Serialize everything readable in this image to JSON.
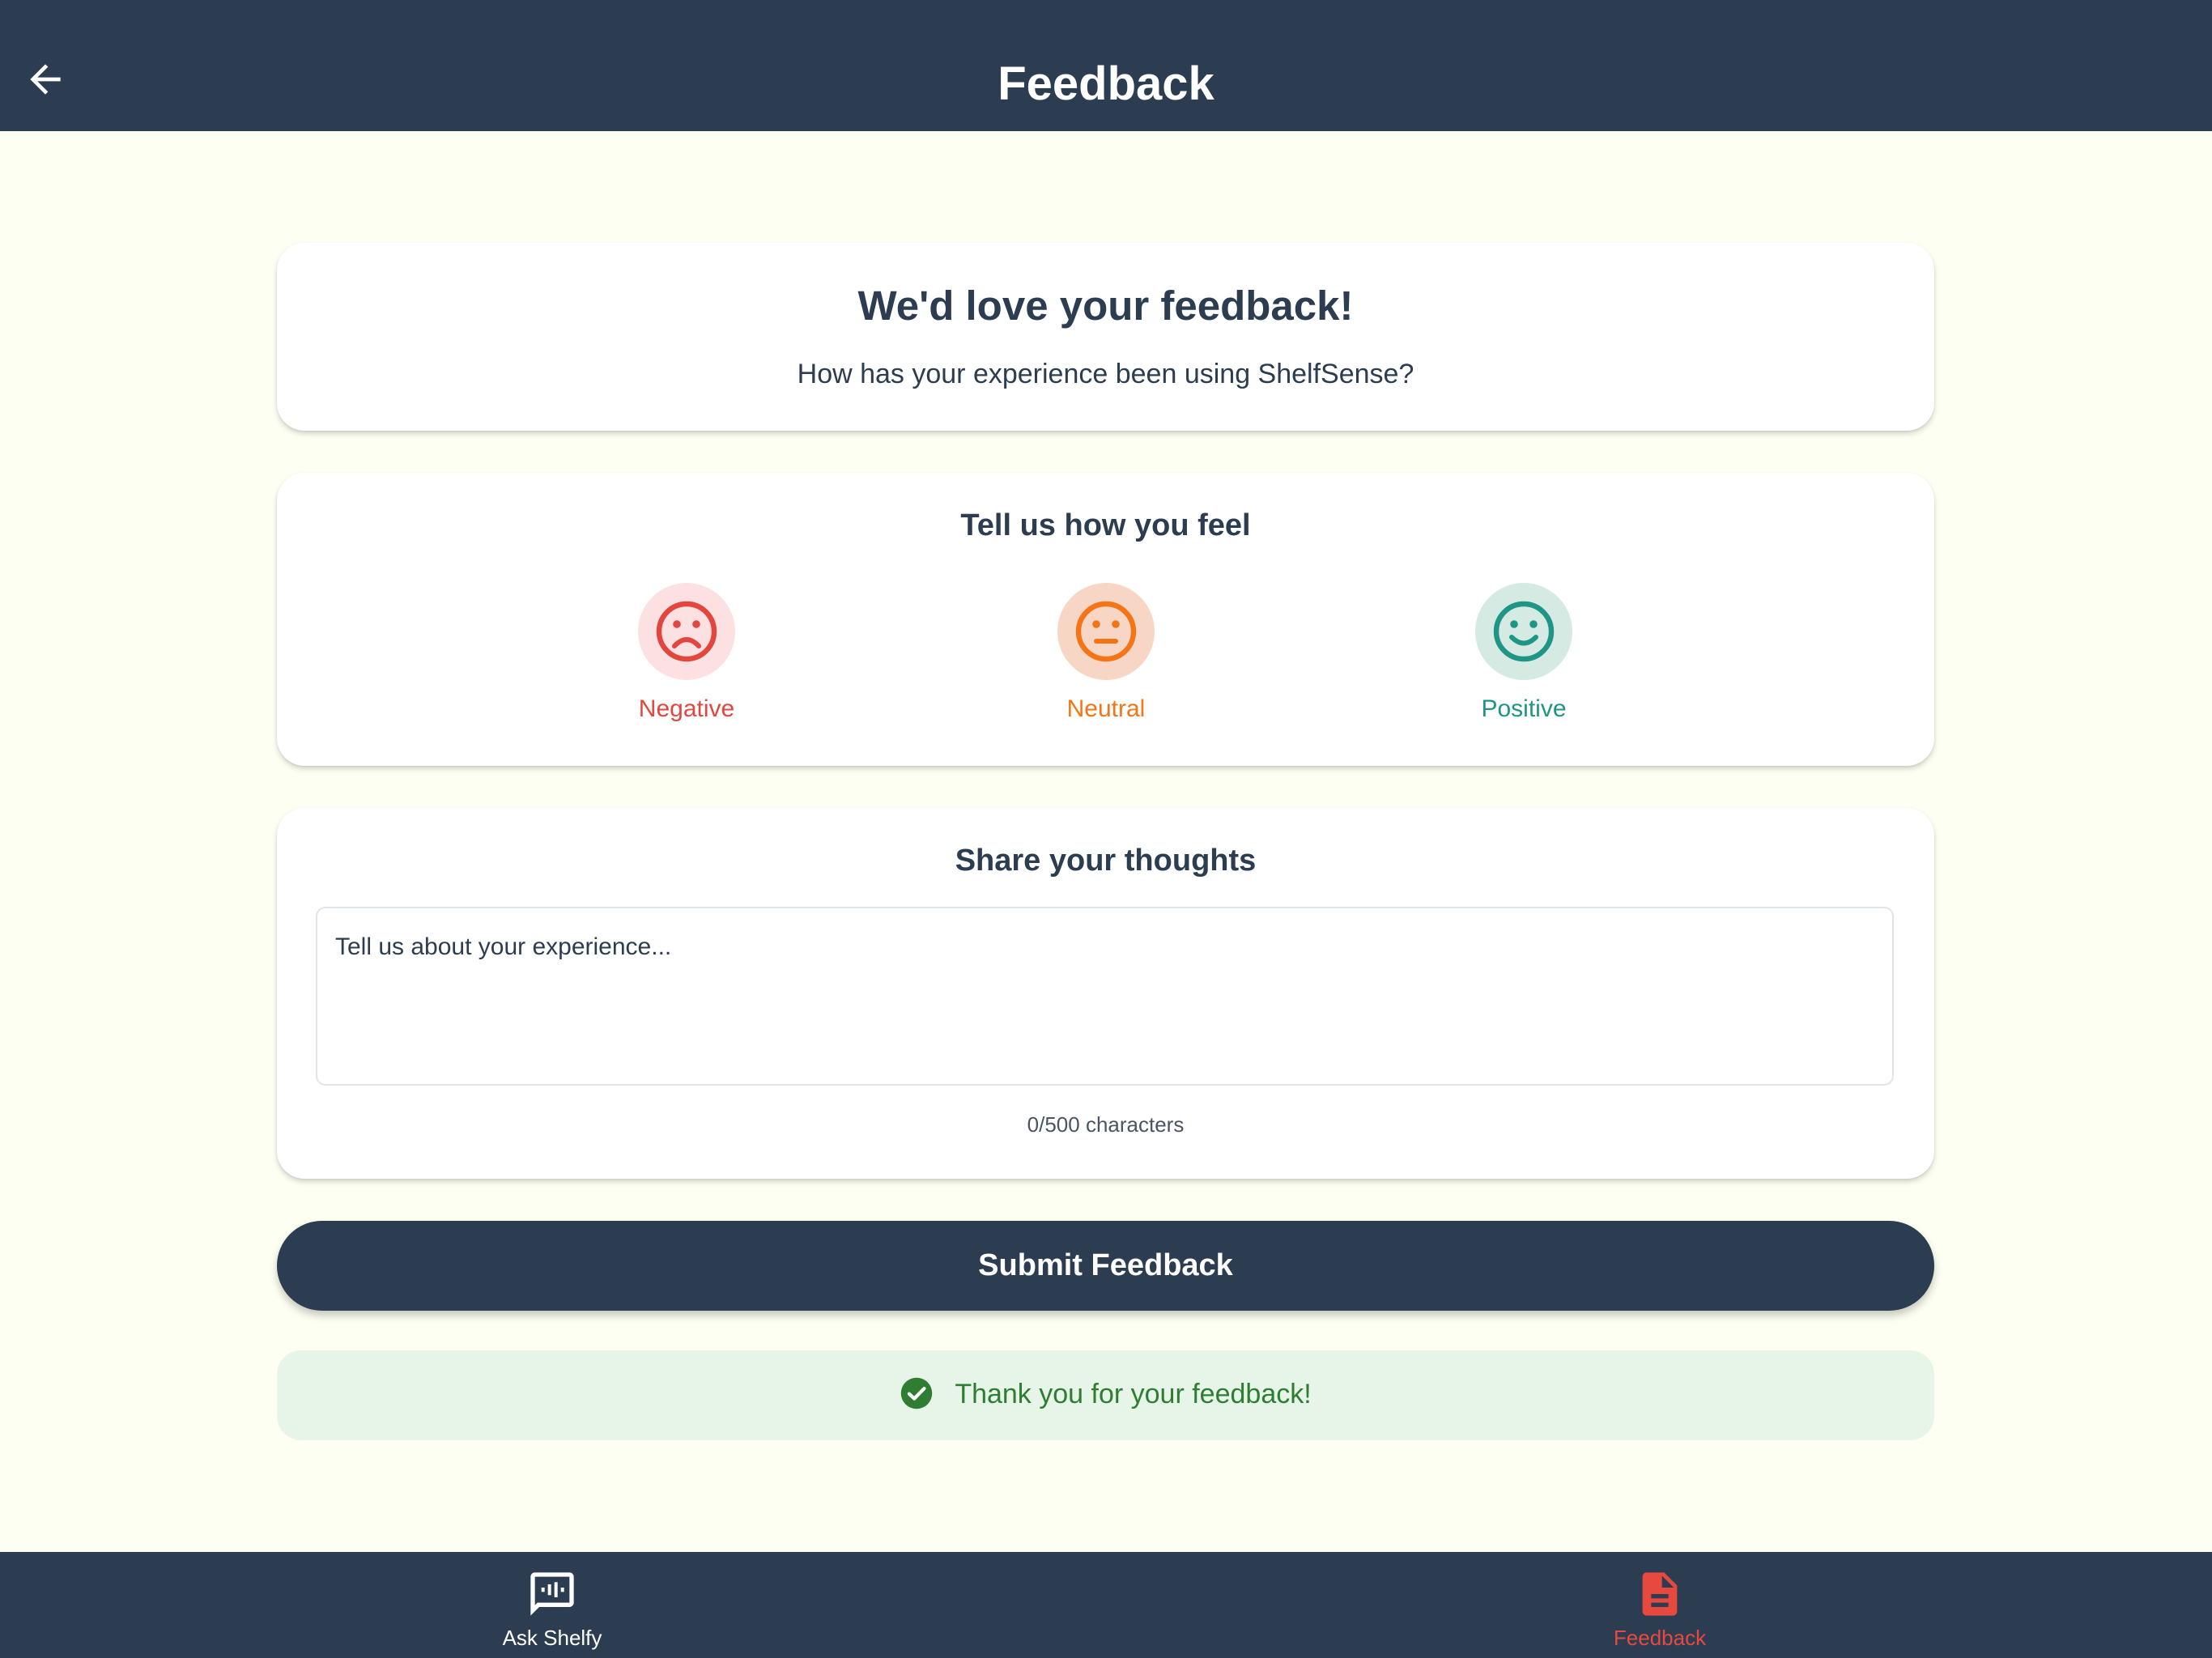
{
  "header": {
    "title": "Feedback",
    "back_icon": "arrow-left-icon"
  },
  "intro": {
    "heading": "We'd love your feedback!",
    "subheading": "How has your experience been using ShelfSense?"
  },
  "feel": {
    "heading": "Tell us how you feel",
    "options": [
      {
        "label": "Negative",
        "icon": "sad-face-icon",
        "color": "#e2463f",
        "bg": "#fde0e1"
      },
      {
        "label": "Neutral",
        "icon": "neutral-face-icon",
        "color": "#f57415",
        "bg": "#f8d6c6"
      },
      {
        "label": "Positive",
        "icon": "happy-face-icon",
        "color": "#1e9585",
        "bg": "#d5eae3"
      }
    ]
  },
  "thoughts": {
    "heading": "Share your thoughts",
    "placeholder": "Tell us about your experience...",
    "value": "",
    "char_count": "0/500 characters"
  },
  "submit": {
    "label": "Submit Feedback"
  },
  "success": {
    "message": "Thank you for your feedback!",
    "icon": "check-circle-icon",
    "color": "#2e7d32"
  },
  "bottom_nav": {
    "items": [
      {
        "label": "Ask Shelfy",
        "icon": "voice-chat-icon",
        "active": false
      },
      {
        "label": "Feedback",
        "icon": "document-icon",
        "active": true
      }
    ],
    "active_color": "#e8493f"
  },
  "colors": {
    "primary": "#2d3d51",
    "background": "#fdfff2"
  }
}
